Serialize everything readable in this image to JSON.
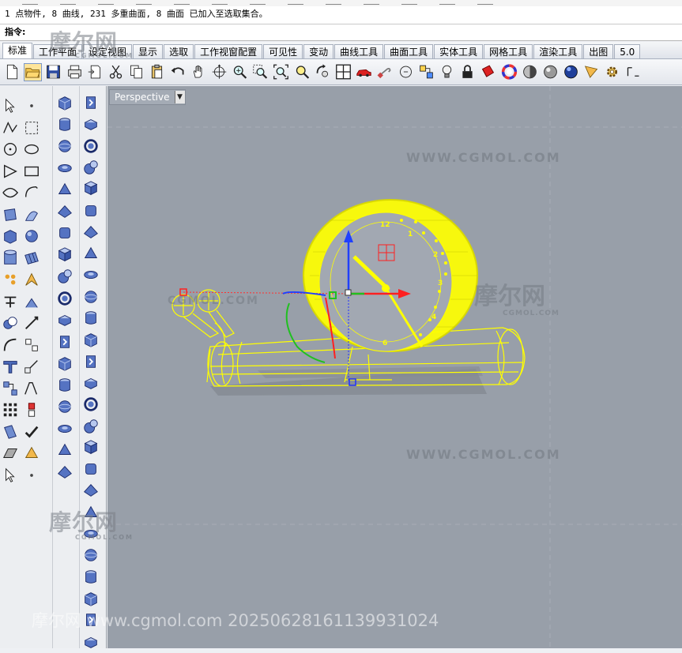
{
  "history": {
    "line": "1 点物件, 8 曲线, 231 多重曲面, 8 曲面 已加入至选取集合。"
  },
  "command": {
    "label": "指令:",
    "value": ""
  },
  "tabs": [
    "标准",
    "工作平面",
    "设定视图",
    "显示",
    "选取",
    "工作视窗配置",
    "可见性",
    "变动",
    "曲线工具",
    "曲面工具",
    "实体工具",
    "网格工具",
    "渲染工具",
    "出图",
    "5.0"
  ],
  "toolbar_icons": [
    "new-file-icon",
    "open-file-icon",
    "save-icon",
    "print-icon",
    "import-icon",
    "cut-icon",
    "copy-icon",
    "paste-icon",
    "undo-icon",
    "pan-hand-icon",
    "rotate-view-icon",
    "zoom-dynamic-icon",
    "zoom-window-icon",
    "zoom-extents-icon",
    "zoom-selected-icon",
    "rotate-camera-icon",
    "four-viewports-icon",
    "car-icon",
    "wrench-icon",
    "circle-tool-icon",
    "properties-icon",
    "lightbulb-icon",
    "lock-icon",
    "paint-bucket-icon",
    "color-wheel-icon",
    "shade-sphere-icon",
    "render-sphere-icon",
    "blue-sphere-icon",
    "arrow-options-icon",
    "gear-icon",
    "more-icon"
  ],
  "viewport": {
    "label": "Perspective",
    "dropdown": "▼"
  },
  "watermarks": {
    "site_url": "WWW.CGMOL.COM",
    "brand_cn": "摩尔网",
    "brand_sub": "CGMOL.COM",
    "footer": "摩尔网 www.cgmol.com 20250628161139931024"
  },
  "clock_numbers": [
    "12",
    "1",
    "2",
    "3",
    "4",
    "5",
    "6"
  ],
  "colors": {
    "viewport_bg": "#989fa9",
    "selection": "#ffff00",
    "x_axis": "#ff2020",
    "y_axis": "#20c020",
    "z_axis": "#2040ff",
    "active_tab_bg": "#ffffff"
  }
}
